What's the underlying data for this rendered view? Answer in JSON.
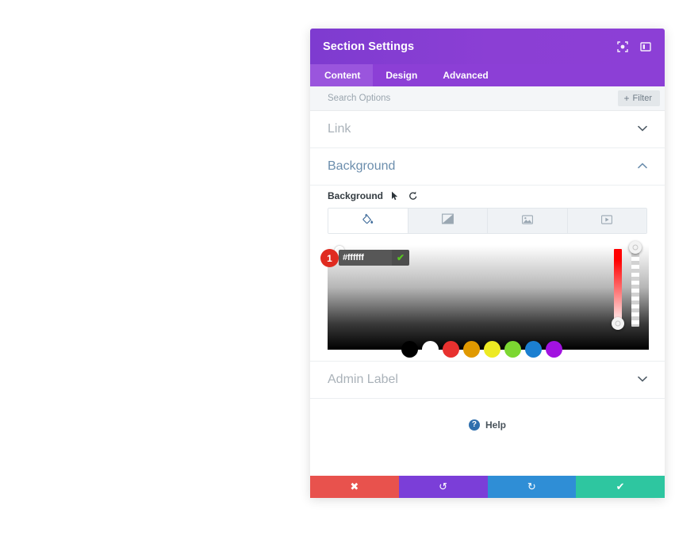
{
  "header": {
    "title": "Section Settings",
    "icons": [
      {
        "name": "target-expand-icon",
        "glyph": "◎"
      },
      {
        "name": "panel-layout-icon",
        "glyph": "▥"
      }
    ]
  },
  "tabs": [
    {
      "label": "Content",
      "active": true
    },
    {
      "label": "Design",
      "active": false
    },
    {
      "label": "Advanced",
      "active": false
    }
  ],
  "search": {
    "placeholder": "Search Options",
    "value": "",
    "filter_label": "Filter",
    "filter_plus": "+"
  },
  "sections": {
    "link": {
      "title": "Link",
      "state": "collapsed",
      "chevron": "⌄"
    },
    "background": {
      "title": "Background",
      "state": "expanded",
      "chevron": "⌃",
      "field_label": "Background",
      "type_tabs": [
        {
          "name": "background-color-tab",
          "icon": "paint-bucket-icon",
          "active": true
        },
        {
          "name": "background-gradient-tab",
          "icon": "gradient-icon",
          "active": false
        },
        {
          "name": "background-image-tab",
          "icon": "image-icon",
          "active": false
        },
        {
          "name": "background-video-tab",
          "icon": "video-icon",
          "active": false
        }
      ],
      "color_picker": {
        "hex_value": "#ffffff",
        "confirm_glyph": "✔",
        "step_badge": "1",
        "swatches": [
          {
            "name": "swatch-black",
            "color": "#000000"
          },
          {
            "name": "swatch-white",
            "color": "#ffffff"
          },
          {
            "name": "swatch-red",
            "color": "#e8312f"
          },
          {
            "name": "swatch-orange",
            "color": "#e09900"
          },
          {
            "name": "swatch-yellow",
            "color": "#edea23"
          },
          {
            "name": "swatch-green",
            "color": "#7cd731"
          },
          {
            "name": "swatch-blue",
            "color": "#1b7fd1"
          },
          {
            "name": "swatch-purple",
            "color": "#a212e0"
          }
        ]
      }
    },
    "admin_label": {
      "title": "Admin Label",
      "state": "collapsed",
      "chevron": "⌄"
    }
  },
  "help": {
    "label": "Help",
    "icon_glyph": "?"
  },
  "footer": {
    "buttons": [
      {
        "name": "cancel-button",
        "glyph": "✖",
        "color": "#e8524d"
      },
      {
        "name": "undo-button",
        "glyph": "↺",
        "color": "#7b3ed8"
      },
      {
        "name": "redo-button",
        "glyph": "↻",
        "color": "#2f8ed6"
      },
      {
        "name": "save-button",
        "glyph": "✔",
        "color": "#2ec6a0"
      }
    ]
  }
}
